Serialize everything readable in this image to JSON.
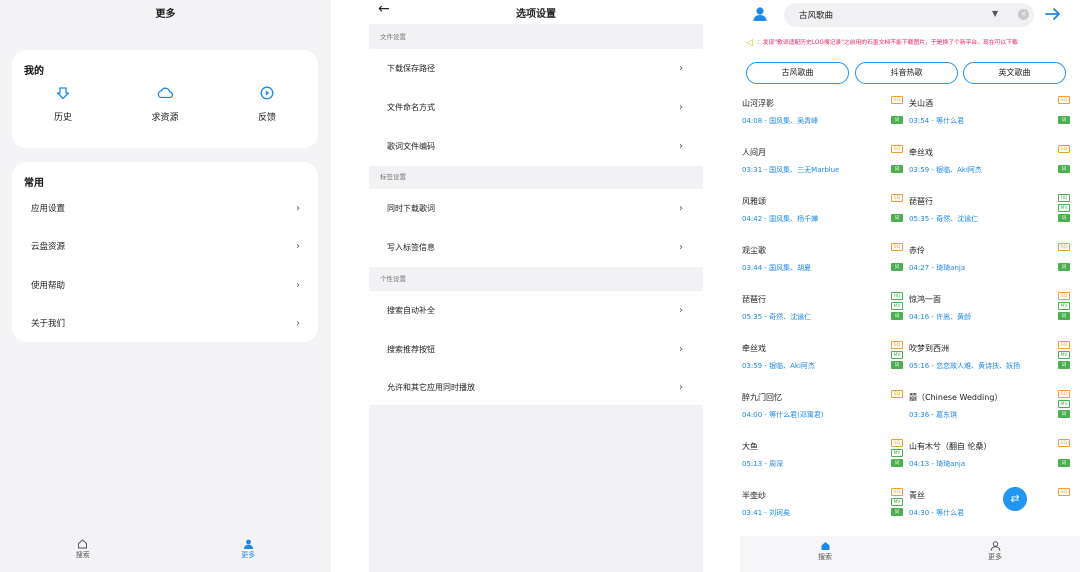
{
  "more": {
    "title": "更多",
    "mine": {
      "heading": "我的",
      "items": [
        {
          "label": "历史",
          "icon": "download-arrow-icon"
        },
        {
          "label": "求资源",
          "icon": "cloud-icon"
        },
        {
          "label": "反馈",
          "icon": "play-circle-icon"
        }
      ]
    },
    "common": {
      "heading": "常用",
      "rows": [
        {
          "label": "应用设置"
        },
        {
          "label": "云盘资源"
        },
        {
          "label": "使用帮助"
        },
        {
          "label": "关于我们"
        }
      ]
    },
    "nav": [
      {
        "label": "搜索",
        "icon": "home-icon",
        "active": false
      },
      {
        "label": "更多",
        "icon": "person-icon",
        "active": true
      }
    ]
  },
  "options": {
    "title": "选项设置",
    "sections": [
      {
        "heading": "文件设置",
        "rows": [
          "下载保存路径",
          "文件命名方式",
          "歌词文件编码"
        ]
      },
      {
        "heading": "标签设置",
        "rows": [
          "同时下载歌词",
          "写入标签信息"
        ]
      },
      {
        "heading": "个性设置",
        "rows": [
          "搜索自动补全",
          "搜索推荐按钮",
          "允许和其它应用同时播放"
        ]
      }
    ]
  },
  "search": {
    "query": "古风歌曲",
    "notice": "：发现\"歌词适配历史LOG搜记录\"之前用的石墨文档不能下载图片，于是换了个新平台。现在可以下载",
    "chips": [
      "古风歌曲",
      "抖音热歌",
      "英文歌曲"
    ],
    "songs_left": [
      {
        "name": "山河浮影",
        "meta": "04:08 - 国风集、吴青峰",
        "tags": [
          "sq",
          "",
          "lrc"
        ]
      },
      {
        "name": "人间月",
        "meta": "03:31 - 国风集、三无Marblue",
        "tags": [
          "sq",
          "",
          "lrc"
        ]
      },
      {
        "name": "风雅颂",
        "meta": "04:42 - 国风集、杨千嬅",
        "tags": [
          "sq",
          "",
          "lrc"
        ]
      },
      {
        "name": "观尘歌",
        "meta": "03:44 - 国风集、胡夏",
        "tags": [
          "sq",
          "",
          "lrc"
        ]
      },
      {
        "name": "琵琶行",
        "meta": "05:35 - 奇然、沈谧仁",
        "tags": [
          "hq",
          "mv",
          "lrc"
        ]
      },
      {
        "name": "牵丝戏",
        "meta": "03:59 - 银临、Aki阿杰",
        "tags": [
          "sq",
          "mv",
          "lrc"
        ]
      },
      {
        "name": "醉九门回忆",
        "meta": "04:00 - 等什么君(邓寓君)",
        "tags": [
          "sq",
          "",
          ""
        ]
      },
      {
        "name": "大鱼",
        "meta": "05:13 - 周深",
        "tags": [
          "sq",
          "mv",
          "lrc"
        ]
      },
      {
        "name": "半壶纱",
        "meta": "03:41 - 刘珂矣",
        "tags": [
          "sq",
          "mv",
          "lrc"
        ]
      }
    ],
    "songs_right": [
      {
        "name": "关山酒",
        "meta": "03:54 - 等什么君",
        "tags": [
          "sq",
          "",
          "lrc"
        ]
      },
      {
        "name": "牵丝戏",
        "meta": "03:59 - 银临、Aki阿杰",
        "tags": [
          "sq",
          "",
          "lrc"
        ]
      },
      {
        "name": "琵琶行",
        "meta": "05:35 - 奇然、沈谧仁",
        "tags": [
          "hq",
          "mv",
          "lrc"
        ]
      },
      {
        "name": "赤伶",
        "meta": "04:27 - 琦琦anja",
        "tags": [
          "sq",
          "",
          "lrc"
        ]
      },
      {
        "name": "惊鸿一面",
        "meta": "04:16 - 许嵩、黄龄",
        "tags": [
          "sq",
          "mv",
          "lrc"
        ]
      },
      {
        "name": "吹梦到西洲",
        "meta": "05:16 - 恋恋故人难、黄诗扶、妖扬",
        "tags": [
          "sq",
          "mv",
          "lrc"
        ]
      },
      {
        "name": "囍（Chinese Wedding）",
        "meta": "03:36 - 葛东琪",
        "tags": [
          "sq",
          "mv",
          "lrc"
        ]
      },
      {
        "name": "山有木兮（翻自 伦桑）",
        "meta": "04:13 - 琦琦anja",
        "tags": [
          "sq",
          "",
          "lrc"
        ]
      },
      {
        "name": "青丝",
        "meta": "04:30 - 等什么君",
        "tags": [
          "sq",
          "",
          ""
        ]
      }
    ],
    "nav": [
      {
        "label": "搜索",
        "icon": "home-icon",
        "active": true
      },
      {
        "label": "更多",
        "icon": "person-icon",
        "active": false
      }
    ]
  }
}
